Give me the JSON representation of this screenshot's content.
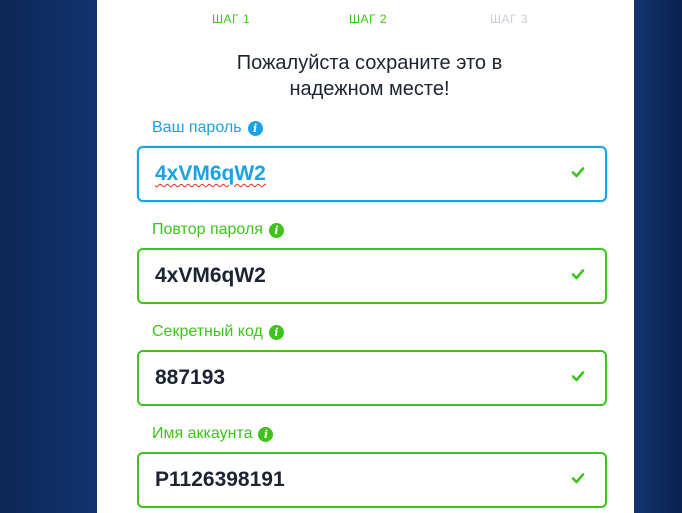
{
  "steps": [
    {
      "label": "ШАГ 1",
      "state": "done"
    },
    {
      "label": "ШАГ 2",
      "state": "done"
    },
    {
      "label": "ШАГ 3",
      "state": "pending"
    }
  ],
  "heading": {
    "line1": "Пожалуйста сохраните это в",
    "line2": "надежном месте!"
  },
  "fields": {
    "password": {
      "label": "Ваш пароль",
      "value": "4xVM6qW2",
      "icon": "info-icon",
      "status": "check-icon"
    },
    "password_repeat": {
      "label": "Повтор пароля",
      "value": "4xVM6qW2",
      "icon": "info-icon",
      "status": "check-icon"
    },
    "secret_code": {
      "label": "Секретный код",
      "value": "887193",
      "icon": "info-icon",
      "status": "check-icon"
    },
    "account_name": {
      "label": "Имя аккаунта",
      "value": "P1126398191",
      "icon": "info-icon",
      "status": "check-icon"
    }
  },
  "colors": {
    "accent_blue": "#1aa2e6",
    "success_green": "#3cc41a",
    "background_navy": "#0f2a5c",
    "text_dark": "#1b2433"
  }
}
